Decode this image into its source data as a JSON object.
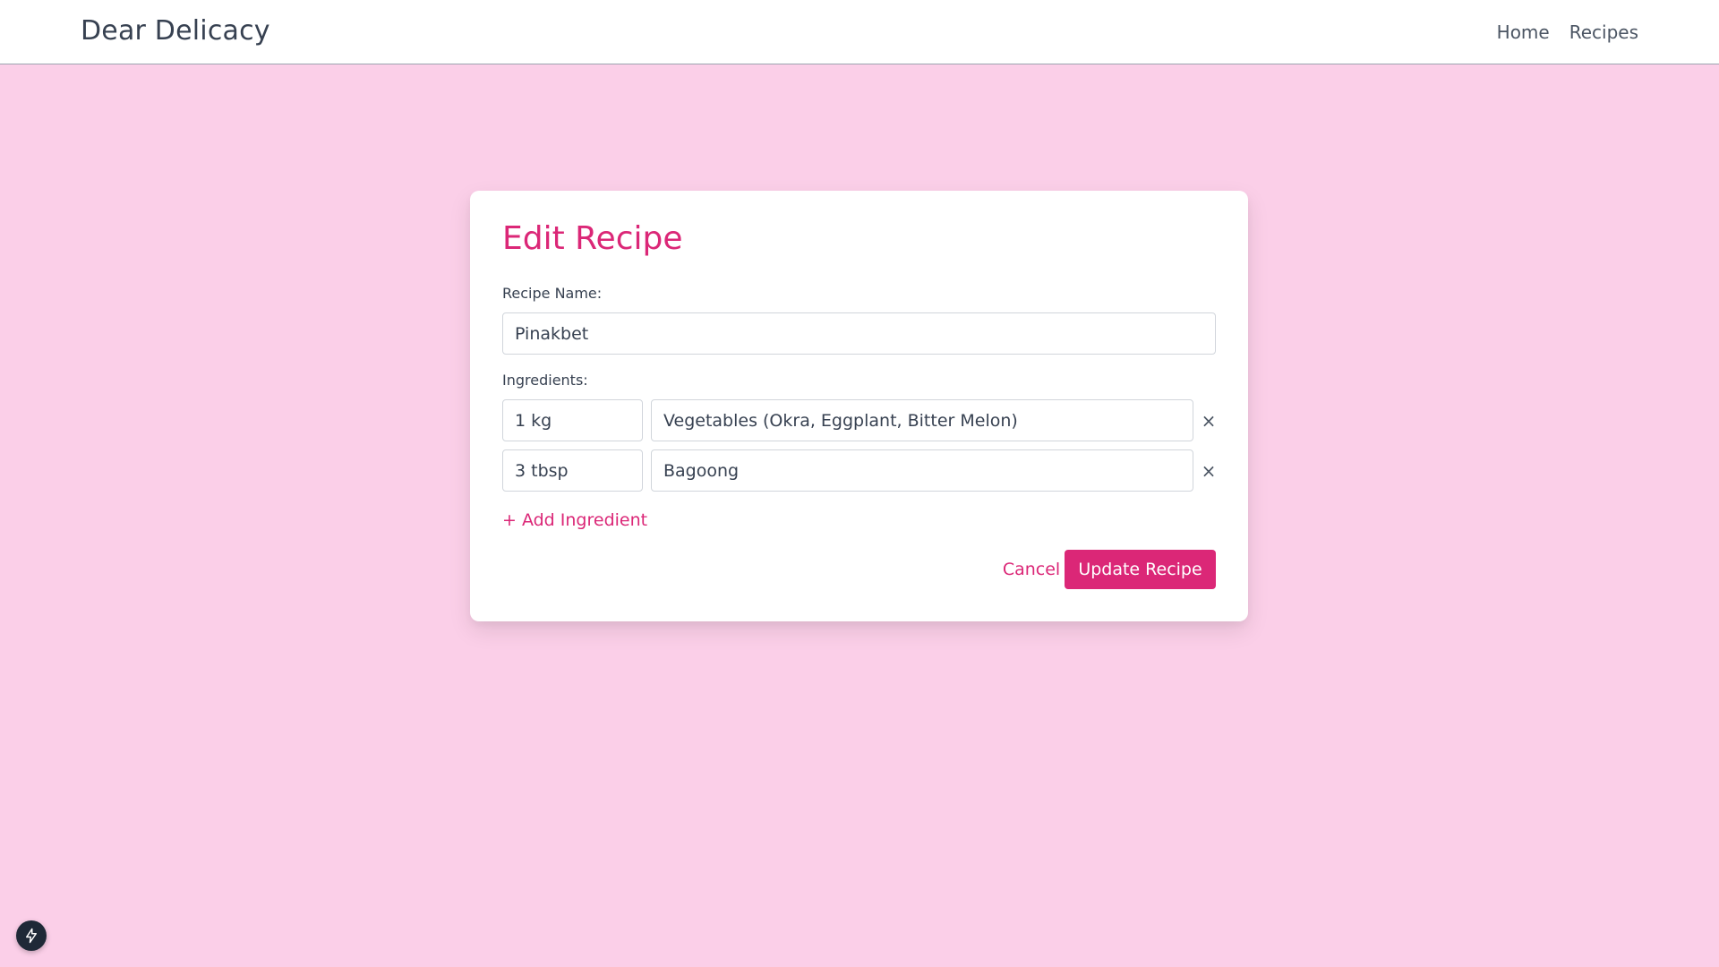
{
  "header": {
    "brand": "Dear Delicacy",
    "nav": [
      "Home",
      "Recipes"
    ]
  },
  "form": {
    "title": "Edit Recipe",
    "recipe_name_label": "Recipe Name:",
    "recipe_name_value": "Pinakbet",
    "ingredients_label": "Ingredients:",
    "ingredients": [
      {
        "quantity": "1 kg",
        "name": "Vegetables (Okra, Eggplant, Bitter Melon)"
      },
      {
        "quantity": "3 tbsp",
        "name": "Bagoong"
      }
    ],
    "remove_icon": "×",
    "add_ingredient_label": "+ Add Ingredient",
    "cancel_label": "Cancel",
    "submit_label": "Update Recipe"
  },
  "colors": {
    "accent": "#db2777",
    "background": "#fbcfe8"
  },
  "dev_badge_icon": "lightning-icon"
}
